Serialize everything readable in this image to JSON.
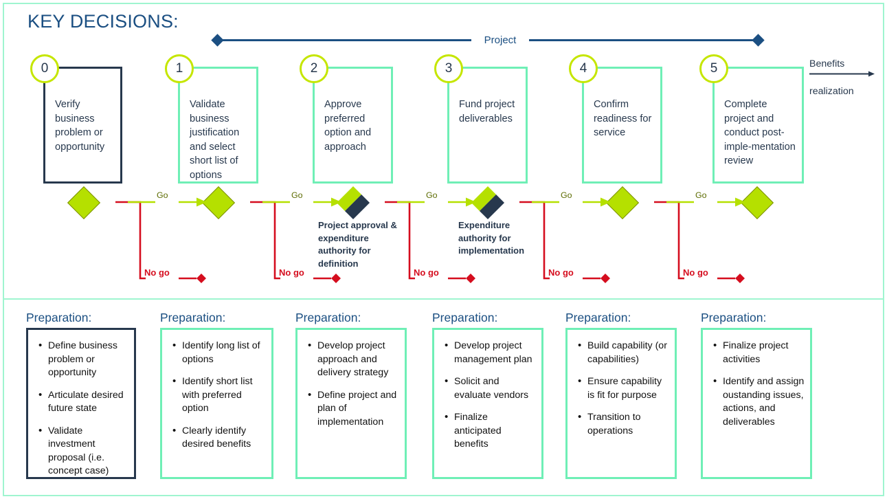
{
  "title": "KEY DECISIONS:",
  "colors": {
    "frame": "#9FF5D0",
    "mint": "#6FEFB6",
    "navy": "#27384D",
    "title_blue": "#1B4F82",
    "lime": "#B5E000",
    "circle_lime": "#C5E600",
    "red": "#D50D1E",
    "go_green": "#B5E000"
  },
  "project_bar": {
    "label": "Project"
  },
  "benefits": {
    "line1": "Benefits",
    "line2": "realization",
    "icon": "arrow-right-icon"
  },
  "stages": [
    {
      "num": "0",
      "text": "Verify business problem or opportunity",
      "style": "dark"
    },
    {
      "num": "1",
      "text": "Validate business justification and select short list of options",
      "style": "mint"
    },
    {
      "num": "2",
      "text": "Approve preferred option and approach",
      "style": "mint"
    },
    {
      "num": "3",
      "text": "Fund project deliverables",
      "style": "mint"
    },
    {
      "num": "4",
      "text": "Confirm readiness for service",
      "style": "mint"
    },
    {
      "num": "5",
      "text": "Complete project and conduct post-imple-mentation review",
      "style": "mint"
    }
  ],
  "decisions": {
    "go_label": "Go",
    "nogo_label": "No go",
    "gate_notes": [
      "Project approval & expenditure authority for definition",
      "Expenditure authority for implementation"
    ],
    "diamonds": [
      {
        "type": "full"
      },
      {
        "type": "full"
      },
      {
        "type": "half"
      },
      {
        "type": "half"
      },
      {
        "type": "full"
      },
      {
        "type": "full"
      }
    ]
  },
  "preparation": {
    "heading": "Preparation:",
    "columns": [
      {
        "style": "dark",
        "items": [
          "Define business problem or opportunity",
          "Articulate desired future state",
          "Validate investment proposal (i.e. concept case)"
        ]
      },
      {
        "style": "mint",
        "items": [
          "Identify long list of options",
          "Identify short list with preferred option",
          "Clearly identify desired benefits"
        ]
      },
      {
        "style": "mint",
        "items": [
          "Develop project approach and delivery strategy",
          "Define project and plan of implementation"
        ]
      },
      {
        "style": "mint",
        "items": [
          "Develop project management plan",
          "Solicit and evaluate vendors",
          "Finalize anticipated benefits"
        ]
      },
      {
        "style": "mint",
        "items": [
          "Build capability (or capabilities)",
          "Ensure capability is fit for purpose",
          "Transition to operations"
        ]
      },
      {
        "style": "mint",
        "items": [
          "Finalize project activities",
          "Identify and assign oustanding issues, actions, and deliverables"
        ]
      }
    ]
  }
}
